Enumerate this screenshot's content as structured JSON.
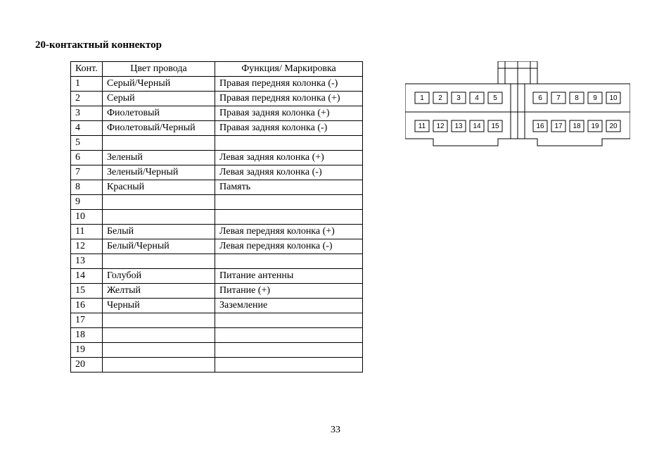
{
  "heading": "20-контактный коннектор",
  "page_number": "33",
  "table": {
    "headers": {
      "pin": "Конт.",
      "color": "Цвет провода",
      "func": "Функция/ Маркировка"
    },
    "rows": [
      {
        "pin": "1",
        "color": "Серый/Черный",
        "func": "Правая передняя колонка (-)"
      },
      {
        "pin": "2",
        "color": "Серый",
        "func": "Правая передняя колонка (+)"
      },
      {
        "pin": "3",
        "color": "Фиолетовый",
        "func": "Правая задняя колонка (+)"
      },
      {
        "pin": "4",
        "color": "Фиолетовый/Черный",
        "func": "Правая задняя колонка (-)"
      },
      {
        "pin": "5",
        "color": "",
        "func": ""
      },
      {
        "pin": "6",
        "color": "Зеленый",
        "func": "Левая задняя колонка (+)"
      },
      {
        "pin": "7",
        "color": "Зеленый/Черный",
        "func": "Левая задняя колонка (-)"
      },
      {
        "pin": "8",
        "color": "Красный",
        "func": "Память"
      },
      {
        "pin": "9",
        "color": "",
        "func": ""
      },
      {
        "pin": "10",
        "color": "",
        "func": ""
      },
      {
        "pin": "11",
        "color": "Белый",
        "func": "Левая передняя колонка (+)"
      },
      {
        "pin": "12",
        "color": "Белый/Черный",
        "func": "Левая передняя колонка (-)"
      },
      {
        "pin": "13",
        "color": "",
        "func": ""
      },
      {
        "pin": "14",
        "color": "Голубой",
        "func": "Питание антенны"
      },
      {
        "pin": "15",
        "color": "Желтый",
        "func": "Питание (+)"
      },
      {
        "pin": "16",
        "color": "Черный",
        "func": "Заземление"
      },
      {
        "pin": "17",
        "color": "",
        "func": ""
      },
      {
        "pin": "18",
        "color": "",
        "func": ""
      },
      {
        "pin": "19",
        "color": "",
        "func": ""
      },
      {
        "pin": "20",
        "color": "",
        "func": ""
      }
    ]
  },
  "connector": {
    "top_row": [
      "1",
      "2",
      "3",
      "4",
      "5",
      "6",
      "7",
      "8",
      "9",
      "10"
    ],
    "bottom_row": [
      "11",
      "12",
      "13",
      "14",
      "15",
      "16",
      "17",
      "18",
      "19",
      "20"
    ]
  }
}
